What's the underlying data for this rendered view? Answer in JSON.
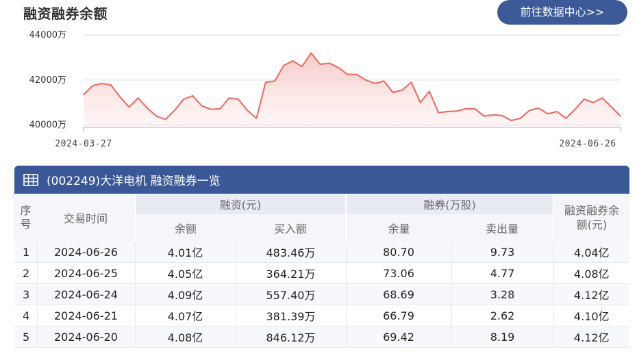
{
  "header": {
    "title": "融资融券余额",
    "data_center_button": "前往数据中心>>"
  },
  "chart_data": {
    "type": "area",
    "title": "融资融券余额",
    "y_unit": "万",
    "ylim": [
      39900,
      44400
    ],
    "yticks": [
      {
        "value": 40000,
        "label": "40000万"
      },
      {
        "value": 42000,
        "label": "42000万"
      },
      {
        "value": 44000,
        "label": "44000万"
      }
    ],
    "x_start_label": "2024-03-27",
    "x_end_label": "2024-06-26",
    "line_color": "#e8726a",
    "fill_color": "#f7cdcb",
    "grid": true,
    "values": [
      41350,
      41750,
      41850,
      41780,
      41250,
      40800,
      41200,
      40750,
      40400,
      40250,
      40650,
      41150,
      41300,
      40850,
      40700,
      40720,
      41200,
      41150,
      40650,
      40300,
      41900,
      41950,
      42650,
      42850,
      42600,
      43200,
      42700,
      42750,
      42550,
      42250,
      42250,
      42000,
      41850,
      41950,
      41450,
      41550,
      41900,
      41000,
      41500,
      40550,
      40600,
      40620,
      40720,
      40720,
      40400,
      40450,
      40420,
      40200,
      40300,
      40650,
      40750,
      40500,
      40600,
      40300,
      40700,
      41150,
      41000,
      41200,
      40800,
      40400
    ]
  },
  "table": {
    "title": "(002249)大洋电机 融资融券一览",
    "headers": {
      "index": "序号",
      "date": "交易时间",
      "margin_group": "融资(元)",
      "short_group": "融券(万股)",
      "total": "融资融券余额(元)",
      "margin_balance": "余额",
      "margin_buy": "买入额",
      "short_balance": "余量",
      "short_sell": "卖出量"
    },
    "rows": [
      {
        "index": "1",
        "date": "2024-06-26",
        "margin_balance": "4.01亿",
        "margin_buy": "483.46万",
        "short_balance": "80.70",
        "short_sell": "9.73",
        "total": "4.04亿"
      },
      {
        "index": "2",
        "date": "2024-06-25",
        "margin_balance": "4.05亿",
        "margin_buy": "364.21万",
        "short_balance": "73.06",
        "short_sell": "4.77",
        "total": "4.08亿"
      },
      {
        "index": "3",
        "date": "2024-06-24",
        "margin_balance": "4.09亿",
        "margin_buy": "557.40万",
        "short_balance": "68.69",
        "short_sell": "3.28",
        "total": "4.12亿"
      },
      {
        "index": "4",
        "date": "2024-06-21",
        "margin_balance": "4.07亿",
        "margin_buy": "381.39万",
        "short_balance": "66.79",
        "short_sell": "2.62",
        "total": "4.10亿"
      },
      {
        "index": "5",
        "date": "2024-06-20",
        "margin_balance": "4.08亿",
        "margin_buy": "846.12万",
        "short_balance": "69.42",
        "short_sell": "8.19",
        "total": "4.12亿"
      }
    ]
  }
}
